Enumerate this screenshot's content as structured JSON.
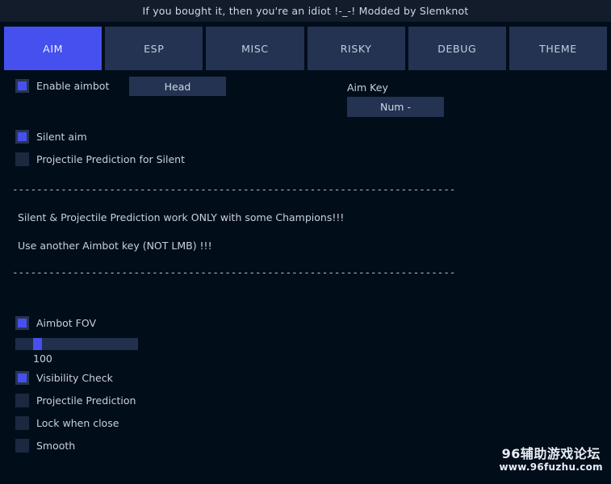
{
  "window": {
    "title": "If you bought it, then you're an idiot !-_-! Modded by Slemknot"
  },
  "tabs": [
    {
      "label": "AIM",
      "active": true
    },
    {
      "label": "ESP",
      "active": false
    },
    {
      "label": "MISC",
      "active": false
    },
    {
      "label": "RISKY",
      "active": false
    },
    {
      "label": "DEBUG",
      "active": false
    },
    {
      "label": "THEME",
      "active": false
    }
  ],
  "aim_panel": {
    "enable_aimbot": {
      "label": "Enable aimbot",
      "checked": true
    },
    "target_bone_button": {
      "label": "Head"
    },
    "aim_key": {
      "label": "Aim Key",
      "value": "Num -"
    },
    "silent_aim": {
      "label": "Silent aim",
      "checked": true
    },
    "projectile_prediction_for_silent": {
      "label": "Projectile Prediction for Silent",
      "checked": false
    },
    "separator_top": "-------------------------------------------------------------------------",
    "note_1": "Silent & Projectile Prediction work ONLY with some Champions!!!",
    "note_2": "Use another Aimbot key (NOT LMB) !!!",
    "separator_bottom": "-------------------------------------------------------------------------",
    "aimbot_fov": {
      "label": "Aimbot FOV",
      "checked": true
    },
    "fov_slider": {
      "value": "100",
      "min": 0,
      "max": 1000,
      "percent": 14
    },
    "visibility_check": {
      "label": "Visibility Check",
      "checked": true
    },
    "projectile_prediction": {
      "label": "Projectile Prediction",
      "checked": false
    },
    "lock_when_close": {
      "label": "Lock when close",
      "checked": false
    },
    "smooth": {
      "label": "Smooth",
      "checked": false
    }
  },
  "watermark": {
    "main": "96辅助游戏论坛",
    "sub": "www.96fuzhu.com"
  },
  "colors": {
    "background": "#020d1a",
    "titlebar": "#121c2b",
    "tab_inactive": "#243352",
    "tab_active": "#4550ee",
    "accent": "#4550ee",
    "text": "#c8d0dc",
    "checkbox_off": "#1c2840",
    "slider_track": "#22304d"
  }
}
